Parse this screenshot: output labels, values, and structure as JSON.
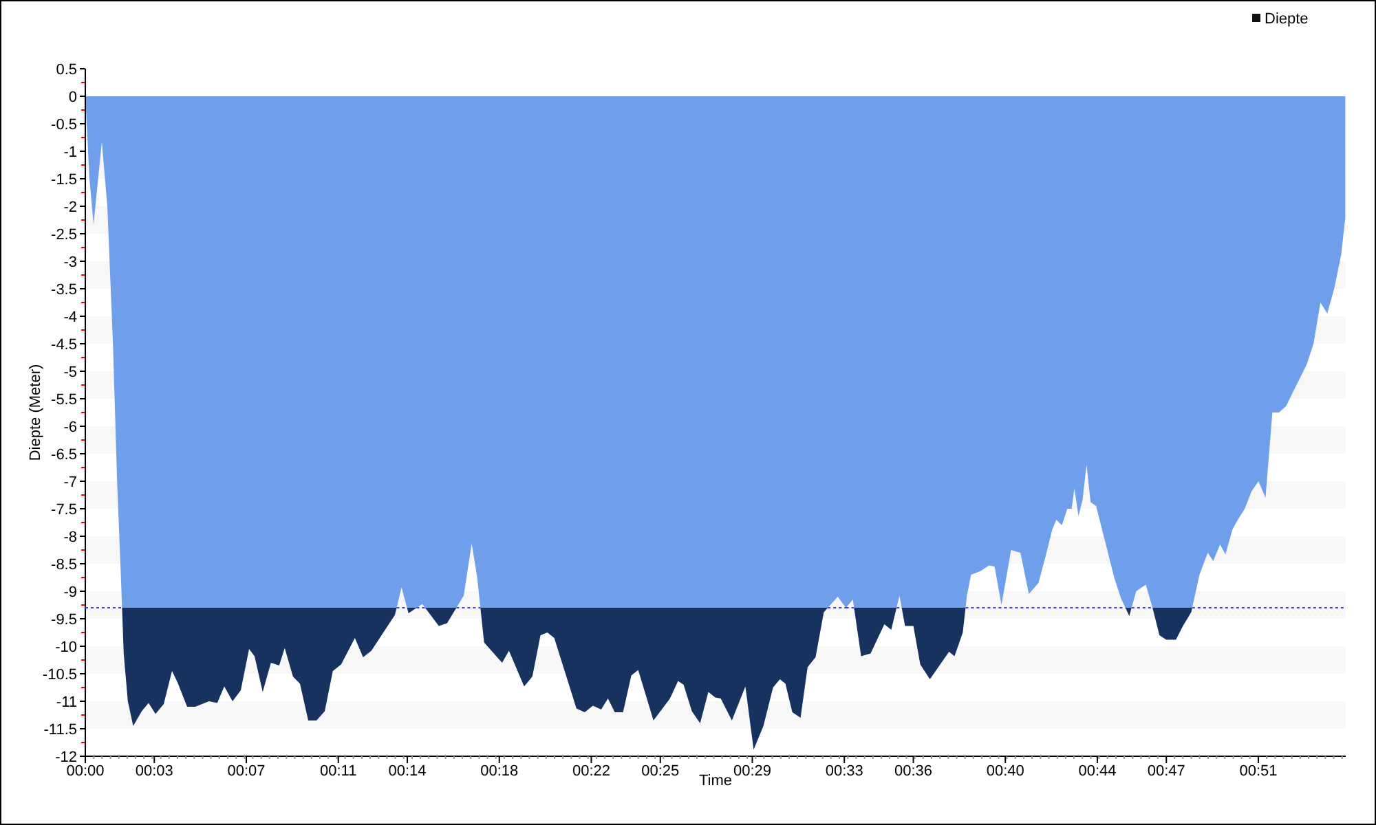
{
  "chart_data": {
    "type": "area",
    "xlabel": "Time",
    "ylabel": "Diepte (Meter)",
    "x": [
      0,
      0.18,
      0.36,
      0.72,
      0.96,
      1.2,
      1.38,
      1.55,
      1.67,
      1.85,
      2.08,
      2.45,
      2.75,
      3.05,
      3.41,
      3.77,
      4.0,
      4.43,
      4.78,
      5.38,
      5.74,
      6.04,
      6.4,
      6.76,
      7.12,
      7.36,
      7.71,
      8.07,
      8.43,
      8.67,
      9.03,
      9.33,
      9.69,
      10.05,
      10.41,
      10.76,
      11.12,
      11.72,
      12.08,
      12.44,
      13.46,
      13.75,
      14.05,
      14.65,
      15.37,
      15.73,
      16.45,
      16.8,
      17.04,
      17.34,
      18.12,
      18.42,
      19.08,
      19.44,
      19.79,
      20.09,
      20.39,
      21.35,
      21.71,
      22.07,
      22.43,
      22.72,
      23.02,
      23.38,
      23.74,
      24.04,
      24.7,
      25.42,
      25.77,
      26.01,
      26.37,
      26.73,
      27.09,
      27.39,
      27.63,
      28.11,
      28.7,
      29.06,
      29.48,
      29.9,
      30.2,
      30.44,
      30.74,
      31.1,
      31.4,
      31.75,
      32.11,
      32.71,
      33.07,
      33.37,
      33.73,
      34.14,
      34.74,
      35.04,
      35.4,
      35.64,
      36.0,
      36.3,
      36.72,
      37.55,
      37.79,
      38.15,
      38.33,
      38.51,
      38.93,
      39.29,
      39.53,
      39.83,
      40.25,
      40.66,
      41.02,
      41.44,
      41.74,
      42.04,
      42.22,
      42.46,
      42.7,
      42.88,
      43.0,
      43.18,
      43.36,
      43.53,
      43.71,
      43.95,
      44.13,
      44.43,
      44.73,
      45.03,
      45.39,
      45.69,
      45.93,
      46.11,
      46.4,
      46.7,
      47.0,
      47.42,
      47.72,
      48.08,
      48.44,
      48.8,
      49.04,
      49.34,
      49.57,
      49.87,
      50.11,
      50.41,
      50.71,
      51.01,
      51.31,
      51.61,
      51.9,
      52.21,
      52.5,
      52.8,
      53.1,
      53.4,
      53.7,
      54.0,
      54.3,
      54.6,
      54.78
    ],
    "series": [
      {
        "name": "Diepte",
        "color": "#6f9fea",
        "values": [
          0,
          -1.5,
          -2.33,
          -0.83,
          -2.0,
          -4.5,
          -7.0,
          -8.75,
          -10.13,
          -11.0,
          -11.45,
          -11.18,
          -11.03,
          -11.23,
          -11.05,
          -10.45,
          -10.65,
          -11.1,
          -11.1,
          -11.0,
          -11.03,
          -10.73,
          -11.0,
          -10.8,
          -10.05,
          -10.18,
          -10.83,
          -10.3,
          -10.35,
          -10.03,
          -10.55,
          -10.68,
          -11.35,
          -11.35,
          -11.18,
          -10.45,
          -10.33,
          -9.85,
          -10.2,
          -10.08,
          -9.43,
          -8.93,
          -9.4,
          -9.23,
          -9.63,
          -9.58,
          -9.08,
          -8.13,
          -8.75,
          -9.93,
          -10.3,
          -10.08,
          -10.73,
          -10.55,
          -9.8,
          -9.75,
          -9.85,
          -11.13,
          -11.2,
          -11.08,
          -11.15,
          -10.95,
          -11.2,
          -11.2,
          -10.53,
          -10.43,
          -11.35,
          -10.95,
          -10.63,
          -10.7,
          -11.18,
          -11.4,
          -10.83,
          -10.93,
          -10.95,
          -11.35,
          -10.73,
          -11.88,
          -11.45,
          -10.75,
          -10.6,
          -10.68,
          -11.2,
          -11.3,
          -10.38,
          -10.2,
          -9.38,
          -9.1,
          -9.3,
          -9.15,
          -10.18,
          -10.13,
          -9.6,
          -9.7,
          -9.08,
          -9.63,
          -9.63,
          -10.33,
          -10.6,
          -10.1,
          -10.18,
          -9.75,
          -9.08,
          -8.7,
          -8.63,
          -8.53,
          -8.55,
          -9.25,
          -8.25,
          -8.3,
          -9.05,
          -8.85,
          -8.38,
          -7.88,
          -7.7,
          -7.8,
          -7.5,
          -7.5,
          -7.13,
          -7.63,
          -7.33,
          -6.7,
          -7.38,
          -7.45,
          -7.75,
          -8.25,
          -8.75,
          -9.13,
          -9.45,
          -9.0,
          -8.93,
          -8.88,
          -9.3,
          -9.8,
          -9.88,
          -9.88,
          -9.63,
          -9.38,
          -8.7,
          -8.3,
          -8.45,
          -8.15,
          -8.33,
          -7.88,
          -7.7,
          -7.5,
          -7.18,
          -7.0,
          -7.3,
          -5.75,
          -5.75,
          -5.63,
          -5.38,
          -5.13,
          -4.88,
          -4.5,
          -3.75,
          -3.95,
          -3.5,
          -2.88,
          -2.2
        ]
      }
    ],
    "xlim": [
      0,
      54.8
    ],
    "ylim": [
      -12,
      0.5
    ],
    "xticks": [
      {
        "value": 0,
        "label": "00:00"
      },
      {
        "value": 3,
        "label": "00:03"
      },
      {
        "value": 7,
        "label": "00:07"
      },
      {
        "value": 11,
        "label": "00:11"
      },
      {
        "value": 14,
        "label": "00:14"
      },
      {
        "value": 18,
        "label": "00:18"
      },
      {
        "value": 22,
        "label": "00:22"
      },
      {
        "value": 25,
        "label": "00:25"
      },
      {
        "value": 29,
        "label": "00:29"
      },
      {
        "value": 33,
        "label": "00:33"
      },
      {
        "value": 36,
        "label": "00:36"
      },
      {
        "value": 40,
        "label": "00:40"
      },
      {
        "value": 44,
        "label": "00:44"
      },
      {
        "value": 47,
        "label": "00:47"
      },
      {
        "value": 51,
        "label": "00:51"
      }
    ],
    "yticks": [
      0.5,
      0,
      -0.5,
      -1,
      -1.5,
      -2,
      -2.5,
      -3,
      -3.5,
      -4,
      -4.5,
      -5,
      -5.5,
      -6,
      -6.5,
      -7,
      -7.5,
      -8,
      -8.5,
      -9,
      -9.5,
      -10,
      -10.5,
      -11,
      -11.5,
      -12
    ]
  }
}
